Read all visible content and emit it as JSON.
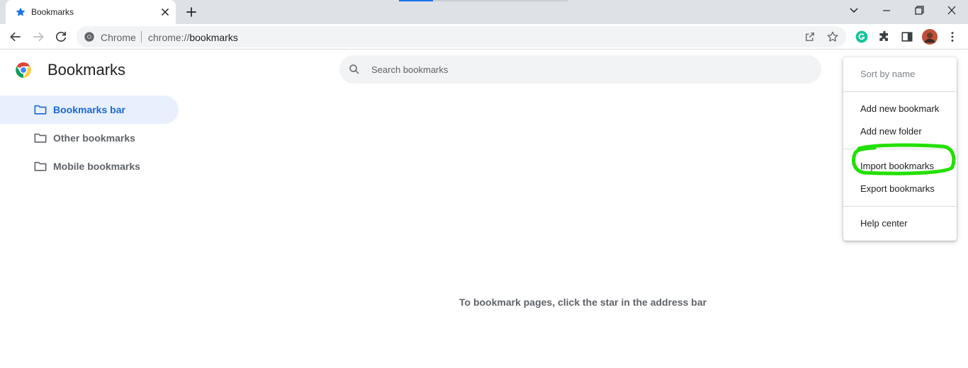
{
  "tab": {
    "title": "Bookmarks"
  },
  "omnibox": {
    "site_chip": "Chrome",
    "url_prefix": "chrome://",
    "url_path": "bookmarks"
  },
  "page": {
    "title": "Bookmarks"
  },
  "search": {
    "placeholder": "Search bookmarks"
  },
  "sidebar": {
    "items": [
      {
        "label": "Bookmarks bar",
        "active": true
      },
      {
        "label": "Other bookmarks",
        "active": false
      },
      {
        "label": "Mobile bookmarks",
        "active": false
      }
    ]
  },
  "empty_state": {
    "message": "To bookmark pages, click the star in the address bar"
  },
  "menu": {
    "items": [
      {
        "label": "Sort by name",
        "disabled": true
      },
      {
        "label": "Add new bookmark"
      },
      {
        "label": "Add new folder"
      },
      {
        "label": "Import bookmarks",
        "highlighted": true
      },
      {
        "label": "Export bookmarks"
      },
      {
        "label": "Help center"
      }
    ]
  },
  "colors": {
    "accent": "#1a73e8",
    "active_bg": "#e8f0fe",
    "active_text": "#1967d2",
    "highlight_annotation": "#22e000",
    "extension_green": "#15c39a"
  },
  "icons": [
    "star-icon",
    "close-icon",
    "plus-icon",
    "chevron-down-icon",
    "minimize-icon",
    "restore-icon",
    "window-close-icon",
    "back-icon",
    "forward-icon",
    "reload-icon",
    "chrome-icon",
    "share-icon",
    "bookmark-star-icon",
    "grammarly-icon",
    "extensions-icon",
    "side-panel-icon",
    "avatar",
    "more-icon",
    "search-icon",
    "folder-icon"
  ]
}
